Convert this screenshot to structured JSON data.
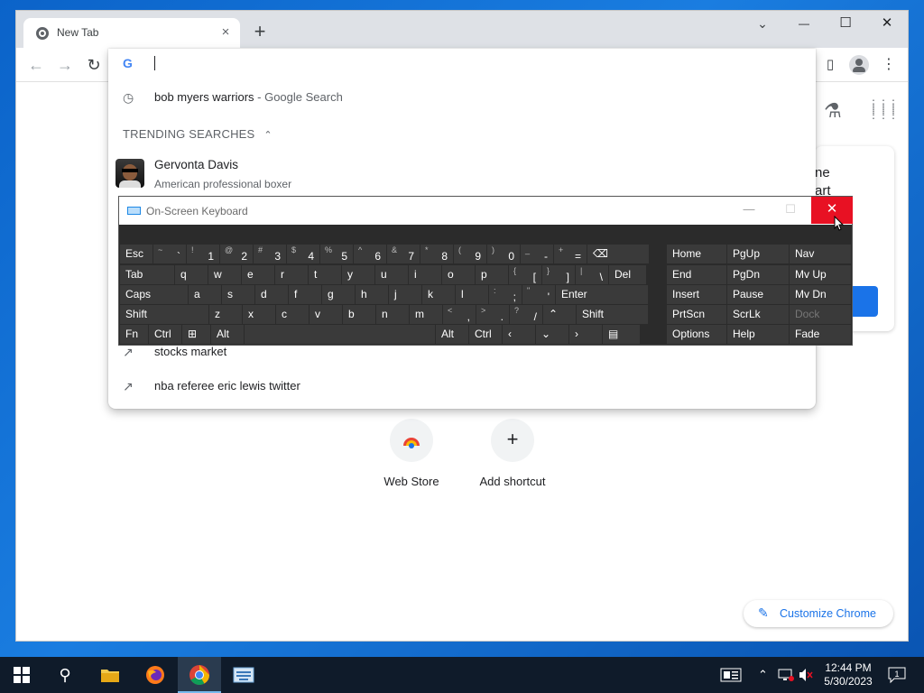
{
  "window": {
    "tab_title": "New Tab",
    "tab_close": "×",
    "new_tab": "+",
    "minimize": "—",
    "maximize": "☐",
    "close": "✕",
    "tab_search": "⌄"
  },
  "toolbar": {
    "back": "←",
    "forward": "→",
    "reload": "↻",
    "side_panel": "▯",
    "menu": "⋮"
  },
  "omnibox": {
    "g_logo": "G",
    "suggestions": [
      {
        "text": "bob myers warriors",
        "sub": " - Google Search",
        "icon": "history-icon"
      }
    ],
    "section_title": "TRENDING SEARCHES",
    "section_chevron": "⌃",
    "entity": {
      "title": "Gervonta Davis",
      "subtitle": "American professional boxer"
    },
    "trending": [
      {
        "text": "stocks market",
        "icon": "trending-icon"
      },
      {
        "text": "nba referee eric lewis twitter",
        "icon": "trending-icon"
      }
    ]
  },
  "ntp": {
    "promo_text_line1": "ne",
    "promo_text_line2": "art",
    "shortcuts": [
      {
        "label": "Web Store",
        "icon": "webstore-icon"
      },
      {
        "label": "Add shortcut",
        "icon": "plus-icon",
        "glyph": "+"
      }
    ],
    "customize": "Customize Chrome",
    "pencil": "✎",
    "labs": "⚗",
    "apps": "⋮⋮⋮"
  },
  "osk": {
    "title": "On-Screen Keyboard",
    "minimize": "—",
    "maximize": "☐",
    "close": "✕",
    "rows": [
      [
        {
          "m": "Esc"
        },
        {
          "s": "~",
          "b": "`"
        },
        {
          "s": "!",
          "b": "1"
        },
        {
          "s": "@",
          "b": "2"
        },
        {
          "s": "#",
          "b": "3"
        },
        {
          "s": "$",
          "b": "4"
        },
        {
          "s": "%",
          "b": "5"
        },
        {
          "s": "^",
          "b": "6"
        },
        {
          "s": "&",
          "b": "7"
        },
        {
          "s": "*",
          "b": "8"
        },
        {
          "s": "(",
          "b": "9"
        },
        {
          "s": ")",
          "b": "0"
        },
        {
          "s": "_",
          "b": "-"
        },
        {
          "s": "+",
          "b": "="
        },
        {
          "m": "⌫"
        }
      ],
      [
        {
          "m": "Tab"
        },
        {
          "m": "q"
        },
        {
          "m": "w"
        },
        {
          "m": "e"
        },
        {
          "m": "r"
        },
        {
          "m": "t"
        },
        {
          "m": "y"
        },
        {
          "m": "u"
        },
        {
          "m": "i"
        },
        {
          "m": "o"
        },
        {
          "m": "p"
        },
        {
          "s": "{",
          "b": "["
        },
        {
          "s": "}",
          "b": "]"
        },
        {
          "s": "|",
          "b": "\\"
        },
        {
          "m": "Del"
        }
      ],
      [
        {
          "m": "Caps"
        },
        {
          "m": "a"
        },
        {
          "m": "s"
        },
        {
          "m": "d"
        },
        {
          "m": "f"
        },
        {
          "m": "g"
        },
        {
          "m": "h"
        },
        {
          "m": "j"
        },
        {
          "m": "k"
        },
        {
          "m": "l"
        },
        {
          "s": ":",
          "b": ";"
        },
        {
          "s": "\"",
          "b": "'"
        },
        {
          "m": "Enter"
        }
      ],
      [
        {
          "m": "Shift"
        },
        {
          "m": "z"
        },
        {
          "m": "x"
        },
        {
          "m": "c"
        },
        {
          "m": "v"
        },
        {
          "m": "b"
        },
        {
          "m": "n"
        },
        {
          "m": "m"
        },
        {
          "s": "<",
          "b": ","
        },
        {
          "s": ">",
          "b": "."
        },
        {
          "s": "?",
          "b": "/"
        },
        {
          "m": "⌃"
        },
        {
          "m": "Shift"
        }
      ],
      [
        {
          "m": "Fn"
        },
        {
          "m": "Ctrl"
        },
        {
          "m": "⊞"
        },
        {
          "m": "Alt"
        },
        {
          "m": ""
        },
        {
          "m": "Alt"
        },
        {
          "m": "Ctrl"
        },
        {
          "m": "‹"
        },
        {
          "m": "⌄"
        },
        {
          "m": "›"
        },
        {
          "m": "▤"
        }
      ]
    ],
    "nav_rows": [
      [
        {
          "m": "Home"
        },
        {
          "m": "PgUp"
        },
        {
          "m": "Nav"
        }
      ],
      [
        {
          "m": "End"
        },
        {
          "m": "PgDn"
        },
        {
          "m": "Mv Up"
        }
      ],
      [
        {
          "m": "Insert"
        },
        {
          "m": "Pause"
        },
        {
          "m": "Mv Dn"
        }
      ],
      [
        {
          "m": "PrtScn"
        },
        {
          "m": "ScrLk"
        },
        {
          "m": "Dock",
          "dim": true
        }
      ],
      [
        {
          "m": "Options"
        },
        {
          "m": "Help"
        },
        {
          "m": "Fade"
        }
      ]
    ]
  },
  "taskbar": {
    "start": "⊞",
    "search": "⚲",
    "apps": [
      "file-explorer-icon",
      "firefox-icon",
      "chrome-icon",
      "osk-icon"
    ],
    "time": "12:44 PM",
    "date": "5/30/2023",
    "notifications": "1"
  }
}
